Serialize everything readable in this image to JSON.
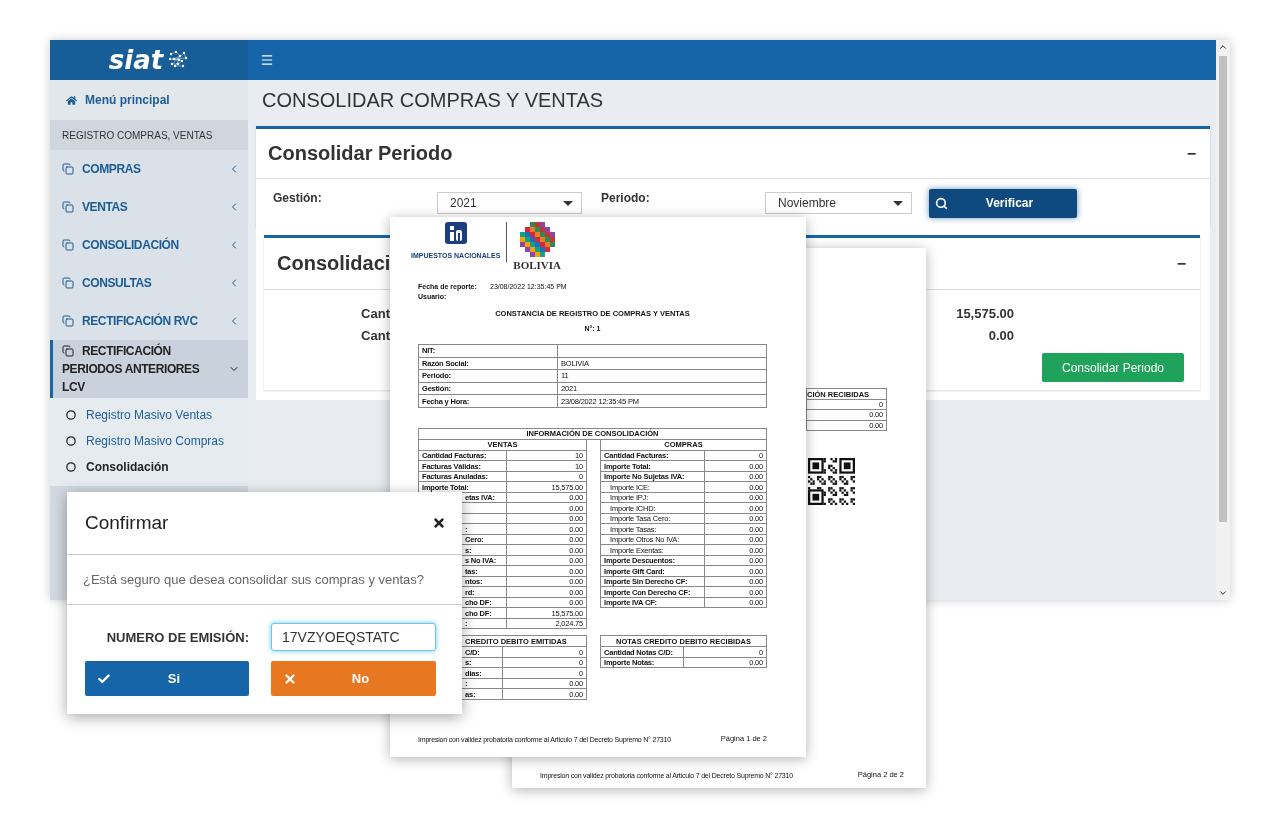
{
  "app": {
    "logo": "siat",
    "sidebar": {
      "home": "Menú principal",
      "section": "REGISTRO COMPRAS, VENTAS",
      "items": [
        {
          "label": "COMPRAS",
          "expanded": false
        },
        {
          "label": "VENTAS",
          "expanded": false
        },
        {
          "label": "CONSOLIDACIÓN",
          "expanded": false
        },
        {
          "label": "CONSULTAS",
          "expanded": false
        },
        {
          "label": "RECTIFICACIÓN RVC",
          "expanded": false
        },
        {
          "label": "RECTIFICACIÓN PERIODOS ANTERIORES LCV",
          "expanded": true,
          "children": [
            {
              "label": "Registro Masivo Ventas",
              "selected": false
            },
            {
              "label": "Registro Masivo Compras",
              "selected": false
            },
            {
              "label": "Consolidación",
              "selected": true
            }
          ]
        }
      ]
    },
    "page_title": "CONSOLIDAR COMPRAS Y VENTAS",
    "period_panel": {
      "title": "Consolidar Periodo",
      "collapse": "−",
      "gestion_label": "Gestión:",
      "gestion_value": "2021",
      "periodo_label": "Periodo:",
      "periodo_value": "Noviembre",
      "verify_button": "Verificar"
    },
    "result_panel": {
      "title": "Consolidaci",
      "collapse": "−",
      "rows": [
        {
          "label": "Cant",
          "value": "15,575.00"
        },
        {
          "label": "Cant",
          "value": "0.00"
        }
      ],
      "button": "Consolidar Periodo"
    }
  },
  "report_page_2": {
    "table_title": "CIÓN RECIBIDAS",
    "values": [
      "0",
      "0.00",
      "0.00"
    ],
    "footer": "Impresion con validez probatoria conforme al Articulo 7 del Decreto Supremo N° 27310",
    "page": "Página 2 de 2"
  },
  "report_page_1": {
    "agency": "IMPUESTOS NACIONALES",
    "country": "BOLIVIA",
    "meta": [
      {
        "label": "Fecha de reporte:",
        "value": "23/08/2022 12:35:45 PM"
      },
      {
        "label": "Usuario:"
      }
    ],
    "title": "CONSTANCIA DE REGISTRO DE COMPRAS Y VENTAS",
    "number": "N°: 1",
    "info": [
      {
        "label": "NIT:"
      },
      {
        "label": "Razón Social:",
        "value": "BOLIVIA"
      },
      {
        "label": "Periodo:",
        "value": "11"
      },
      {
        "label": "Gestión:",
        "value": "2021"
      },
      {
        "label": "Fecha y Hora:",
        "value": "23/08/2022 12:35:45 PM"
      }
    ],
    "consolidation_title": "INFORMACIÓN DE CONSOLIDACIÓN",
    "ventas": {
      "title": "VENTAS",
      "rows": [
        {
          "label": "Cantidad Facturas:",
          "value": "10",
          "clipped": false
        },
        {
          "label": "Facturas Válidas:",
          "value": "10",
          "clipped": false
        },
        {
          "label": "Facturas Anuladas:",
          "value": "0",
          "clipped": false
        },
        {
          "label": "Importe Total:",
          "value": "15,575.00",
          "clipped": false
        },
        {
          "label": "etas IVA:",
          "value": "0.00",
          "clipped": true
        },
        {
          "value": "0.00"
        },
        {
          "value": "0.00"
        },
        {
          "label": ":",
          "value": "0.00",
          "clipped": true
        },
        {
          "label": "Cero:",
          "value": "0.00",
          "clipped": true
        },
        {
          "label": "s:",
          "value": "0.00",
          "clipped": true
        },
        {
          "label": "s No IVA:",
          "value": "0.00",
          "clipped": true
        },
        {
          "label": "tas:",
          "value": "0.00",
          "clipped": true
        },
        {
          "label": "ntos:",
          "value": "0.00",
          "clipped": true
        },
        {
          "label": "rd:",
          "value": "0.00",
          "clipped": true
        },
        {
          "label": "cho DF:",
          "value": "0.00",
          "clipped": true
        },
        {
          "label": "cho DF:",
          "value": "15,575.00",
          "clipped": true
        },
        {
          "label": ":",
          "value": "2,024.75",
          "clipped": true
        }
      ]
    },
    "compras": {
      "title": "COMPRAS",
      "rows": [
        {
          "label": "Cantidad Facturas:",
          "value": "0",
          "kind": "main"
        },
        {
          "label": "Importe Total:",
          "value": "0.00",
          "kind": "main"
        },
        {
          "label": "Importe No Sujetas IVA:",
          "value": "0.00",
          "kind": "main"
        },
        {
          "label": "Importe ICE:",
          "value": "0.00",
          "kind": "sub"
        },
        {
          "label": "Importe IPJ:",
          "value": "0.00",
          "kind": "sub"
        },
        {
          "label": "Importe ICHD:",
          "value": "0.00",
          "kind": "sub"
        },
        {
          "label": "Importe Tasa Cero:",
          "value": "0.00",
          "kind": "sub"
        },
        {
          "label": "Importe Tasas:",
          "value": "0.00",
          "kind": "sub"
        },
        {
          "label": "Importe Otros No IVA:",
          "value": "0.00",
          "kind": "sub"
        },
        {
          "label": "Importe Exentas:",
          "value": "0.00",
          "kind": "sub"
        },
        {
          "label": "Importe Descuentos:",
          "value": "0.00",
          "kind": "main"
        },
        {
          "label": "Importe Gift Card:",
          "value": "0.00",
          "kind": "main"
        },
        {
          "label": "Importe Sin Derecho CF:",
          "value": "0.00",
          "kind": "main"
        },
        {
          "label": "Importe Con Derecho CF:",
          "value": "0.00",
          "kind": "main"
        },
        {
          "label": "Importe IVA CF:",
          "value": "0.00",
          "kind": "main"
        }
      ]
    },
    "notas_emitidas": {
      "title": "CREDITO DEBITO EMITIDAS",
      "clipped": true,
      "rows": [
        {
          "label": "C/D:",
          "value": "0"
        },
        {
          "label": "s:",
          "value": "0"
        },
        {
          "label": "dias:",
          "value": "0"
        },
        {
          "label": ":",
          "value": "0.00"
        },
        {
          "label": "as:",
          "value": "0.00"
        }
      ]
    },
    "notas_recibidas": {
      "title": "NOTAS CREDITO DEBITO RECIBIDAS",
      "clipped": false,
      "rows": [
        {
          "label": "Cantidad Notas C/D:",
          "value": "0"
        },
        {
          "label": "Importe Notas:",
          "value": "0.00"
        }
      ]
    },
    "footer": "Impresion con validez probatoria conforme al Articulo 7 del Decreto Supremo N° 27310",
    "page": "Página 1 de 2"
  },
  "dialog": {
    "title": "Confirmar",
    "message": "¿Está seguro que desea consolidar sus compras y ventas?",
    "field_label": "NUMERO DE EMISIÓN:",
    "field_value": "17VZYOEQSTATC",
    "buttons": [
      {
        "label": "Si",
        "kind": "confirm"
      },
      {
        "label": "No",
        "kind": "cancel"
      }
    ]
  }
}
